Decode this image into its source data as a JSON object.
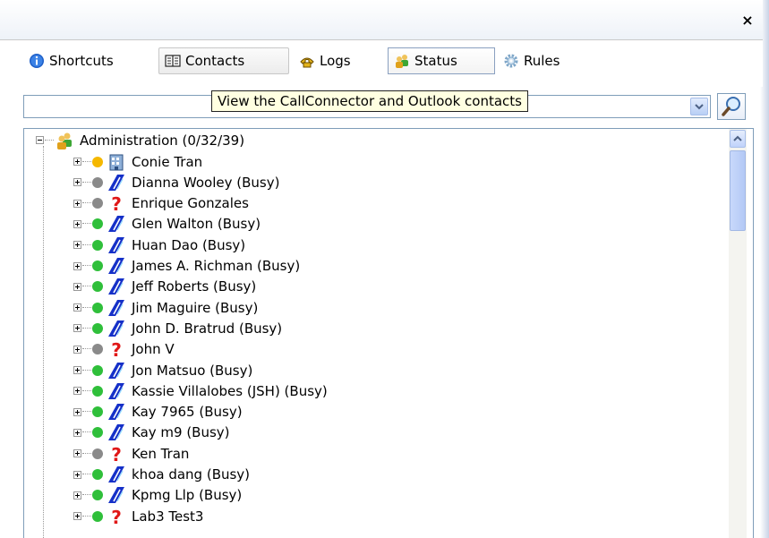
{
  "window": {
    "close_glyph": "×"
  },
  "toolbar": {
    "tabs": [
      {
        "label": "Shortcuts",
        "icon": "info-icon"
      },
      {
        "label": "Contacts",
        "icon": "address-book-icon"
      },
      {
        "label": "Logs",
        "icon": "phone-icon"
      },
      {
        "label": "Status",
        "icon": "users-status-icon"
      },
      {
        "label": "Rules",
        "icon": "gear-icon"
      }
    ]
  },
  "tooltip": {
    "text": "View the CallConnector and Outlook contacts"
  },
  "search": {
    "value": ""
  },
  "tree": {
    "group": {
      "label": "Administration   (0/32/39)"
    },
    "items": [
      {
        "label": "Conie Tran",
        "status_color": "#f5b800",
        "icon": "building-icon"
      },
      {
        "label": "Dianna Wooley (Busy)",
        "status_color": "#8a8a8a",
        "icon": "phone-handset-icon"
      },
      {
        "label": "Enrique Gonzales",
        "status_color": "#8a8a8a",
        "icon": "question-icon"
      },
      {
        "label": "Glen Walton (Busy)",
        "status_color": "#2fbf3a",
        "icon": "phone-handset-icon"
      },
      {
        "label": "Huan Dao (Busy)",
        "status_color": "#2fbf3a",
        "icon": "phone-handset-icon"
      },
      {
        "label": "James A. Richman (Busy)",
        "status_color": "#2fbf3a",
        "icon": "phone-handset-icon"
      },
      {
        "label": "Jeff Roberts (Busy)",
        "status_color": "#2fbf3a",
        "icon": "phone-handset-icon"
      },
      {
        "label": "Jim Maguire (Busy)",
        "status_color": "#2fbf3a",
        "icon": "phone-handset-icon"
      },
      {
        "label": "John D. Bratrud  (Busy)",
        "status_color": "#2fbf3a",
        "icon": "phone-handset-icon"
      },
      {
        "label": "John V",
        "status_color": "#8a8a8a",
        "icon": "question-icon"
      },
      {
        "label": "Jon Matsuo (Busy)",
        "status_color": "#2fbf3a",
        "icon": "phone-handset-icon"
      },
      {
        "label": "Kassie Villalobes (JSH) (Busy)",
        "status_color": "#2fbf3a",
        "icon": "phone-handset-icon"
      },
      {
        "label": "Kay 7965 (Busy)",
        "status_color": "#2fbf3a",
        "icon": "phone-handset-icon"
      },
      {
        "label": "Kay m9 (Busy)",
        "status_color": "#2fbf3a",
        "icon": "phone-handset-icon"
      },
      {
        "label": "Ken Tran",
        "status_color": "#8a8a8a",
        "icon": "question-icon"
      },
      {
        "label": "khoa dang (Busy)",
        "status_color": "#2fbf3a",
        "icon": "phone-handset-icon"
      },
      {
        "label": "Kpmg Llp (Busy)",
        "status_color": "#2fbf3a",
        "icon": "phone-handset-icon"
      },
      {
        "label": "Lab3 Test3",
        "status_color": "#2fbf3a",
        "icon": "question-icon"
      }
    ]
  }
}
